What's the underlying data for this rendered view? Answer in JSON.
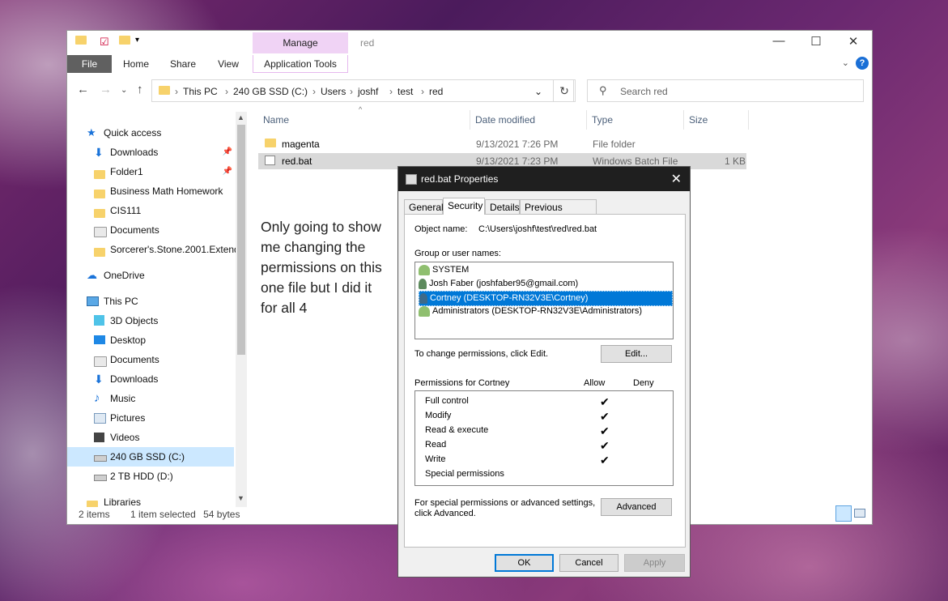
{
  "explorer": {
    "title": "red",
    "manage_tab": "Manage",
    "ribbon_tabs": [
      "File",
      "Home",
      "Share",
      "View"
    ],
    "app_tools_tab": "Application Tools",
    "breadcrumb": [
      "This PC",
      "240 GB SSD (C:)",
      "Users",
      "joshf",
      "test",
      "red"
    ],
    "search_placeholder": "Search red",
    "nav": [
      {
        "label": "Quick access",
        "icon": "star-icon"
      },
      {
        "label": "Downloads",
        "icon": "download-arrow-icon",
        "pinned": true
      },
      {
        "label": "Folder1",
        "icon": "folder-icon",
        "pinned": true
      },
      {
        "label": "Business Math Homework",
        "icon": "folder-icon"
      },
      {
        "label": "CIS111",
        "icon": "folder-icon"
      },
      {
        "label": "Documents",
        "icon": "documents-icon"
      },
      {
        "label": "Sorcerer's.Stone.2001.Extende",
        "icon": "folder-icon"
      },
      {
        "label": "OneDrive",
        "icon": "cloud-icon"
      },
      {
        "label": "This PC",
        "icon": "computer-icon"
      },
      {
        "label": "3D Objects",
        "icon": "cube-icon"
      },
      {
        "label": "Desktop",
        "icon": "desktop-icon"
      },
      {
        "label": "Documents",
        "icon": "documents-icon"
      },
      {
        "label": "Downloads",
        "icon": "download-arrow-icon"
      },
      {
        "label": "Music",
        "icon": "music-note-icon"
      },
      {
        "label": "Pictures",
        "icon": "pictures-icon"
      },
      {
        "label": "Videos",
        "icon": "film-icon"
      },
      {
        "label": "240 GB SSD (C:)",
        "icon": "drive-icon",
        "selected": true
      },
      {
        "label": "2 TB HDD (D:)",
        "icon": "drive-icon"
      },
      {
        "label": "Libraries",
        "icon": "libraries-icon"
      }
    ],
    "columns": [
      "Name",
      "Date modified",
      "Type",
      "Size"
    ],
    "files": [
      {
        "name": "magenta",
        "date": "9/13/2021 7:26 PM",
        "type": "File folder",
        "size": ""
      },
      {
        "name": "red.bat",
        "date": "9/13/2021 7:23 PM",
        "type": "Windows Batch File",
        "size": "1 KB"
      }
    ],
    "status": {
      "items": "2 items",
      "selected": "1 item selected",
      "size": "54 bytes"
    },
    "annotation": "Only going to show me changing the permissions on this one file but I did it for all 4"
  },
  "dialog": {
    "title": "red.bat Properties",
    "tabs": [
      "General",
      "Security",
      "Details",
      "Previous Versions"
    ],
    "object_name_label": "Object name:",
    "object_name": "C:\\Users\\joshf\\test\\red\\red.bat",
    "group_label": "Group or user names:",
    "users": [
      {
        "name": "SYSTEM"
      },
      {
        "name": "Josh Faber (joshfaber95@gmail.com)"
      },
      {
        "name": "Cortney (DESKTOP-RN32V3E\\Cortney)",
        "selected": true
      },
      {
        "name": "Administrators (DESKTOP-RN32V3E\\Administrators)"
      }
    ],
    "change_text": "To change permissions, click Edit.",
    "edit_button": "Edit...",
    "perms_label": "Permissions for Cortney",
    "allow_label": "Allow",
    "deny_label": "Deny",
    "permissions": [
      {
        "name": "Full control",
        "allow": true
      },
      {
        "name": "Modify",
        "allow": true
      },
      {
        "name": "Read & execute",
        "allow": true
      },
      {
        "name": "Read",
        "allow": true
      },
      {
        "name": "Write",
        "allow": true
      },
      {
        "name": "Special permissions",
        "allow": false
      }
    ],
    "check_glyph": "✔",
    "advanced_text_1": "For special permissions or advanced settings,",
    "advanced_text_2": "click Advanced.",
    "advanced_button": "Advanced",
    "ok_button": "OK",
    "cancel_button": "Cancel",
    "apply_button": "Apply"
  }
}
